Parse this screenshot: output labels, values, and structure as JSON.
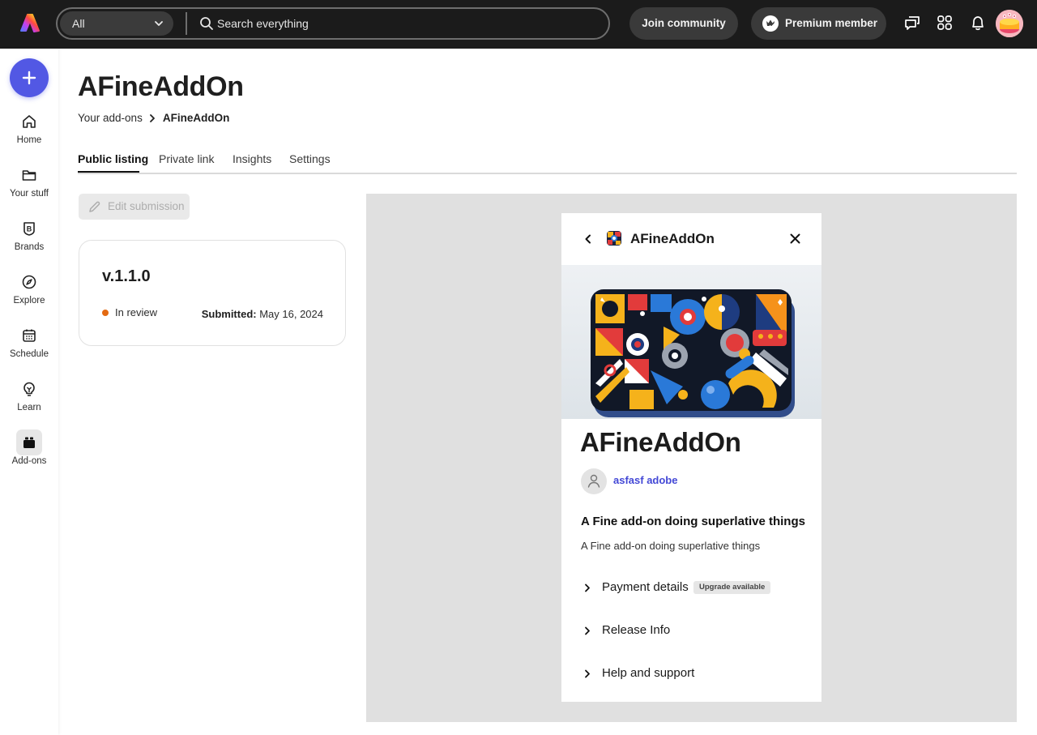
{
  "topbar": {
    "logo": "adobe-express-logo",
    "scope_selected": "All",
    "search_placeholder": "Search everything",
    "join_label": "Join community",
    "premium_label": "Premium member",
    "icons": [
      "chat-icon",
      "apps-grid-icon",
      "bell-icon",
      "avatar"
    ]
  },
  "rail": {
    "create_label": "Create",
    "items": [
      {
        "label": "Home",
        "icon": "home-icon"
      },
      {
        "label": "Your stuff",
        "icon": "folder-icon"
      },
      {
        "label": "Brands",
        "icon": "brand-icon"
      },
      {
        "label": "Explore",
        "icon": "compass-icon"
      },
      {
        "label": "Schedule",
        "icon": "calendar-icon"
      },
      {
        "label": "Learn",
        "icon": "lightbulb-icon"
      },
      {
        "label": "Add-ons",
        "icon": "addons-icon",
        "active": true
      }
    ]
  },
  "main": {
    "title": "AFineAddOn",
    "breadcrumb": {
      "parent": "Your add-ons",
      "current": "AFineAddOn"
    },
    "tabs": [
      {
        "label": "Public listing",
        "active": true
      },
      {
        "label": "Private link"
      },
      {
        "label": "Insights"
      },
      {
        "label": "Settings"
      }
    ],
    "edit_label": "Edit submission",
    "version_card": {
      "version": "v.1.1.0",
      "status": "In review",
      "status_color": "#e36a12",
      "submitted_label": "Submitted:",
      "submitted_date": "May 16, 2024"
    }
  },
  "preview": {
    "header_title": "AFineAddOn",
    "name": "AFineAddOn",
    "author": "asfasf adobe",
    "tagline_heading": "A Fine add-on doing superlative things",
    "tagline": "A Fine add-on doing superlative things",
    "sections": [
      {
        "label": "Payment details",
        "badge": "Upgrade available"
      },
      {
        "label": "Release Info"
      },
      {
        "label": "Help and support"
      }
    ]
  },
  "colors": {
    "accent": "#5258e4",
    "link": "#4348d6",
    "topbar_bg": "#1b1b1b",
    "preview_bg": "#e0e0e0"
  }
}
